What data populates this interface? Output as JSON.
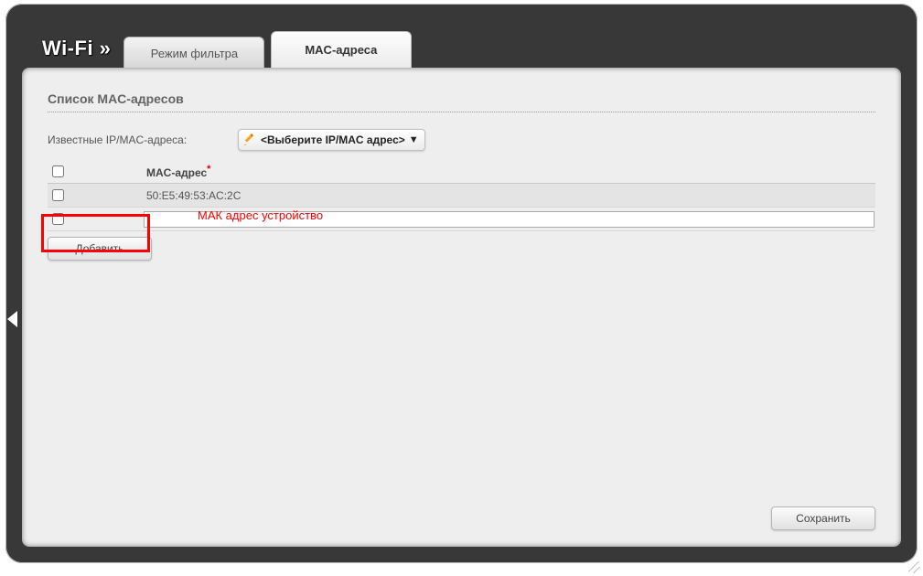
{
  "header": {
    "title": "Wi-Fi »",
    "tabs": [
      {
        "label": "Режим фильтра",
        "active": false
      },
      {
        "label": "MAC-адреса",
        "active": true
      }
    ]
  },
  "section": {
    "title": "Список MAC-адресов",
    "known_label": "Известные IP/MAC-адреса:",
    "dropdown_text": "<Выберите IP/MAC адрес>"
  },
  "table": {
    "col_mac": "MAC-адрес",
    "rows": [
      {
        "checked": false,
        "mac": "50:E5:49:53:AC:2C"
      }
    ],
    "input_value": "",
    "annotation": "МАК адрес устройство"
  },
  "buttons": {
    "add": "Добавить",
    "save": "Сохранить"
  }
}
